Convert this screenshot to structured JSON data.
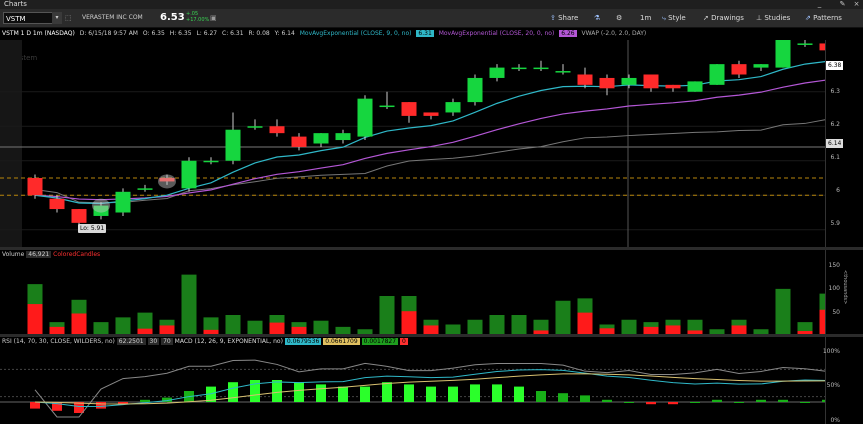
{
  "window": {
    "title": "Charts"
  },
  "toolbar": {
    "symbol": "VSTM",
    "company": "VERASTEM INC COM",
    "price": "6.53",
    "change": "+.05",
    "change_pct": "+17.00%",
    "share": "Share",
    "timeframe": "1m",
    "style": "Style",
    "drawings": "Drawings",
    "studies": "Studies",
    "patterns": "Patterns"
  },
  "studybar": {
    "title": "VSTM 1 D 1m (NASDAQ)",
    "date": "D: 6/15/18 9:57 AM",
    "open": "O: 6.35",
    "high": "H: 6.35",
    "low": "L: 6.27",
    "close": "C: 6.31",
    "range": "R: 0.08",
    "y": "Y: 6.14",
    "ema9_label": "MovAvgExponential (CLOSE, 9, 0, no)",
    "ema9_value": "6.31",
    "ema20_label": "MovAvgExponential (CLOSE, 20, 0, no)",
    "ema20_value": "6.26",
    "vwap_label": "VWAP (-2.0, 2.0, DAY)",
    "watermark": "Verastem"
  },
  "price_panel": {
    "axis_ticks": [
      "6.3",
      "6.2",
      "6.1",
      "6",
      "5.9"
    ],
    "last_price_tag": "6.38",
    "crosshair_tag": "6.14",
    "low_marker": "Lo: 5.91"
  },
  "volume_panel": {
    "label": "Volume",
    "value": "46,921",
    "colored_label": "ColoredCandles",
    "axis_ticks": [
      "150",
      "100",
      "50"
    ],
    "axis_unit": "<thousands>"
  },
  "lower_panel": {
    "rsi_label": "RSI (14, 70, 30, CLOSE, WILDERS, no)",
    "rsi_value": "62.2501",
    "ob": "30",
    "os": "70",
    "macd_label": "MACD (12, 26, 9, EXPONENTIAL, no)",
    "macd_value": "0.0679536",
    "signal_value": "0.0661709",
    "diff_value": "0.0017827",
    "zero_value": "0",
    "axis_ticks": [
      "100%",
      "50%",
      "0%"
    ]
  },
  "colors": {
    "up": "#16d63f",
    "down": "#ff2a2a",
    "ema9": "#2fb8c8",
    "ema20": "#b457d6",
    "vol_up": "#1a7f1a",
    "vol_down": "#ff1a1a"
  },
  "chart_data": {
    "type": "candlestick",
    "candles": [
      {
        "o": 6.05,
        "c": 6.0,
        "h": 6.06,
        "l": 5.99
      },
      {
        "o": 5.99,
        "c": 5.96,
        "h": 6.0,
        "l": 5.95
      },
      {
        "o": 5.96,
        "c": 5.92,
        "h": 5.96,
        "l": 5.91
      },
      {
        "o": 5.94,
        "c": 5.97,
        "h": 5.98,
        "l": 5.93
      },
      {
        "o": 5.95,
        "c": 6.01,
        "h": 6.02,
        "l": 5.94
      },
      {
        "o": 6.02,
        "c": 6.02,
        "h": 6.03,
        "l": 6.01
      },
      {
        "o": 6.05,
        "c": 6.04,
        "h": 6.06,
        "l": 6.03
      },
      {
        "o": 6.02,
        "c": 6.1,
        "h": 6.11,
        "l": 6.01
      },
      {
        "o": 6.1,
        "c": 6.1,
        "h": 6.11,
        "l": 6.09
      },
      {
        "o": 6.1,
        "c": 6.19,
        "h": 6.24,
        "l": 6.09
      },
      {
        "o": 6.2,
        "c": 6.2,
        "h": 6.22,
        "l": 6.19
      },
      {
        "o": 6.2,
        "c": 6.18,
        "h": 6.22,
        "l": 6.17
      },
      {
        "o": 6.17,
        "c": 6.14,
        "h": 6.18,
        "l": 6.13
      },
      {
        "o": 6.15,
        "c": 6.18,
        "h": 6.18,
        "l": 6.14
      },
      {
        "o": 6.16,
        "c": 6.18,
        "h": 6.19,
        "l": 6.15
      },
      {
        "o": 6.17,
        "c": 6.28,
        "h": 6.29,
        "l": 6.16
      },
      {
        "o": 6.26,
        "c": 6.26,
        "h": 6.3,
        "l": 6.25
      },
      {
        "o": 6.27,
        "c": 6.23,
        "h": 6.27,
        "l": 6.21
      },
      {
        "o": 6.24,
        "c": 6.23,
        "h": 6.24,
        "l": 6.22
      },
      {
        "o": 6.24,
        "c": 6.27,
        "h": 6.28,
        "l": 6.23
      },
      {
        "o": 6.27,
        "c": 6.34,
        "h": 6.35,
        "l": 6.26
      },
      {
        "o": 6.34,
        "c": 6.37,
        "h": 6.38,
        "l": 6.33
      },
      {
        "o": 6.37,
        "c": 6.37,
        "h": 6.38,
        "l": 6.36
      },
      {
        "o": 6.37,
        "c": 6.37,
        "h": 6.39,
        "l": 6.36
      },
      {
        "o": 6.36,
        "c": 6.36,
        "h": 6.38,
        "l": 6.35
      },
      {
        "o": 6.35,
        "c": 6.32,
        "h": 6.37,
        "l": 6.31
      },
      {
        "o": 6.34,
        "c": 6.31,
        "h": 6.35,
        "l": 6.29
      },
      {
        "o": 6.32,
        "c": 6.34,
        "h": 6.35,
        "l": 6.31
      },
      {
        "o": 6.35,
        "c": 6.31,
        "h": 6.35,
        "l": 6.3
      },
      {
        "o": 6.32,
        "c": 6.31,
        "h": 6.32,
        "l": 6.3
      },
      {
        "o": 6.3,
        "c": 6.33,
        "h": 6.33,
        "l": 6.3
      },
      {
        "o": 6.32,
        "c": 6.38,
        "h": 6.38,
        "l": 6.32
      },
      {
        "o": 6.38,
        "c": 6.35,
        "h": 6.39,
        "l": 6.34
      },
      {
        "o": 6.37,
        "c": 6.38,
        "h": 6.38,
        "l": 6.36
      },
      {
        "o": 6.37,
        "c": 6.45,
        "h": 6.45,
        "l": 6.37
      },
      {
        "o": 6.44,
        "c": 6.44,
        "h": 6.45,
        "l": 6.43
      },
      {
        "o": 6.44,
        "c": 6.42,
        "h": 6.45,
        "l": 6.41
      }
    ],
    "volume": [
      105,
      25,
      72,
      25,
      35,
      45,
      30,
      125,
      35,
      40,
      28,
      40,
      25,
      28,
      15,
      10,
      80,
      80,
      30,
      20,
      30,
      40,
      40,
      30,
      70,
      75,
      20,
      30,
      25,
      30,
      30,
      10,
      30,
      10,
      95,
      25,
      85
    ],
    "volume_up": [
      false,
      true,
      false,
      true,
      true,
      false,
      true,
      true,
      false,
      true,
      true,
      false,
      false,
      true,
      true,
      true,
      true,
      false,
      false,
      true,
      true,
      true,
      true,
      false,
      true,
      false,
      false,
      true,
      false,
      true,
      false,
      true,
      true,
      true,
      true,
      false,
      true
    ],
    "macd_hist": [
      -3,
      -4,
      -5,
      -3,
      -1,
      1,
      2,
      5,
      7,
      9,
      10,
      10,
      9,
      8,
      7,
      7,
      9,
      8,
      7,
      7,
      8,
      8,
      7,
      5,
      4,
      3,
      1,
      0,
      -1,
      -1,
      0,
      1,
      0,
      1,
      1,
      0,
      1
    ],
    "axis_price_range": [
      5.85,
      6.45
    ],
    "volume_range": [
      0,
      160
    ],
    "rsi_range": [
      0,
      100
    ]
  }
}
